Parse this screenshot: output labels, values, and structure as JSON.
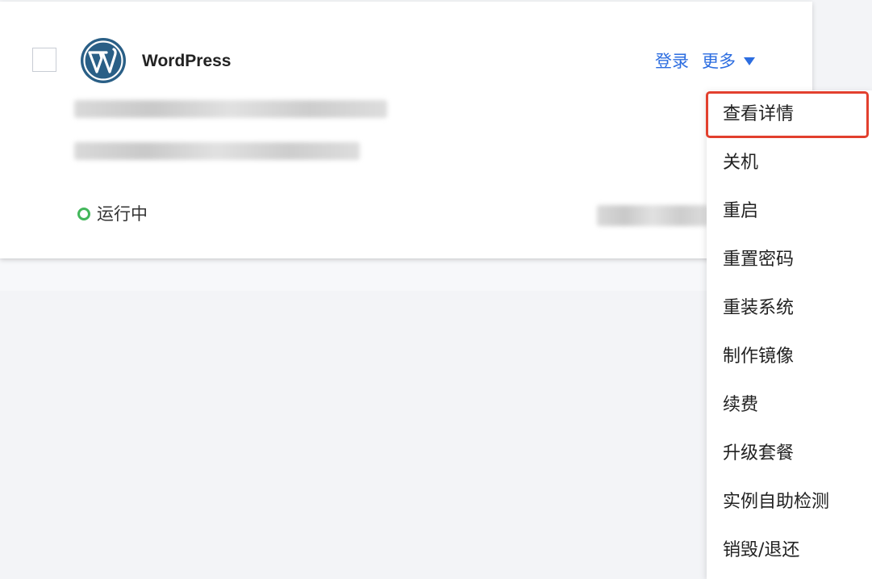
{
  "card": {
    "app_name": "WordPress",
    "logo_icon": "wordpress-logo-icon",
    "actions": {
      "login_label": "登录",
      "more_label": "更多"
    },
    "status": {
      "label": "运行中",
      "color": "#43b75b"
    }
  },
  "dropdown": {
    "items": [
      {
        "label": "查看详情",
        "highlighted": true
      },
      {
        "label": "关机"
      },
      {
        "label": "重启"
      },
      {
        "label": "重置密码"
      },
      {
        "label": "重装系统"
      },
      {
        "label": "制作镜像"
      },
      {
        "label": "续费"
      },
      {
        "label": "升级套餐"
      },
      {
        "label": "实例自助检测"
      },
      {
        "label": "销毁/退还"
      }
    ],
    "highlight_color": "#e2402e"
  },
  "colors": {
    "link": "#2c6de0",
    "logo": "#2a5f86"
  }
}
